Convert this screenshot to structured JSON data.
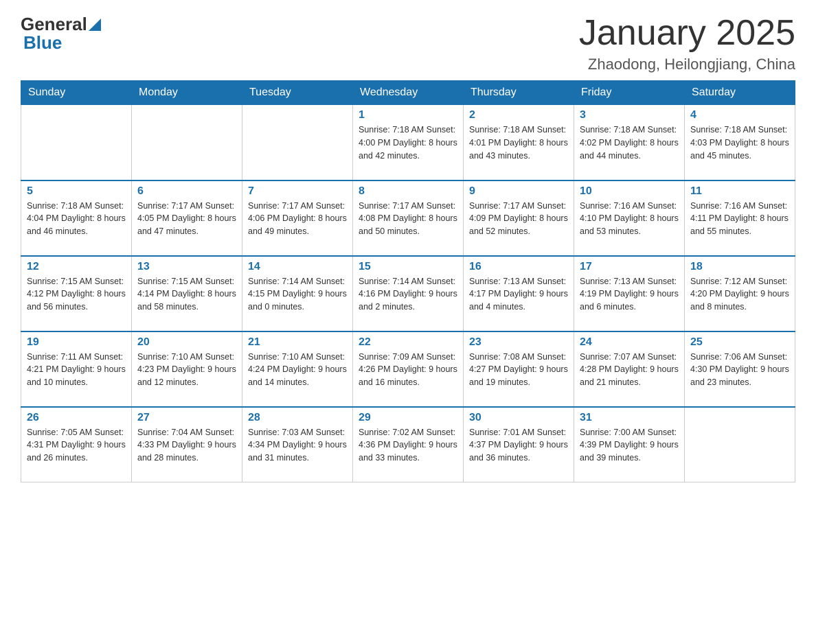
{
  "header": {
    "logo_general": "General",
    "logo_blue": "Blue",
    "title": "January 2025",
    "subtitle": "Zhaodong, Heilongjiang, China"
  },
  "calendar": {
    "days": [
      "Sunday",
      "Monday",
      "Tuesday",
      "Wednesday",
      "Thursday",
      "Friday",
      "Saturday"
    ],
    "weeks": [
      [
        {
          "day": "",
          "info": ""
        },
        {
          "day": "",
          "info": ""
        },
        {
          "day": "",
          "info": ""
        },
        {
          "day": "1",
          "info": "Sunrise: 7:18 AM\nSunset: 4:00 PM\nDaylight: 8 hours\nand 42 minutes."
        },
        {
          "day": "2",
          "info": "Sunrise: 7:18 AM\nSunset: 4:01 PM\nDaylight: 8 hours\nand 43 minutes."
        },
        {
          "day": "3",
          "info": "Sunrise: 7:18 AM\nSunset: 4:02 PM\nDaylight: 8 hours\nand 44 minutes."
        },
        {
          "day": "4",
          "info": "Sunrise: 7:18 AM\nSunset: 4:03 PM\nDaylight: 8 hours\nand 45 minutes."
        }
      ],
      [
        {
          "day": "5",
          "info": "Sunrise: 7:18 AM\nSunset: 4:04 PM\nDaylight: 8 hours\nand 46 minutes."
        },
        {
          "day": "6",
          "info": "Sunrise: 7:17 AM\nSunset: 4:05 PM\nDaylight: 8 hours\nand 47 minutes."
        },
        {
          "day": "7",
          "info": "Sunrise: 7:17 AM\nSunset: 4:06 PM\nDaylight: 8 hours\nand 49 minutes."
        },
        {
          "day": "8",
          "info": "Sunrise: 7:17 AM\nSunset: 4:08 PM\nDaylight: 8 hours\nand 50 minutes."
        },
        {
          "day": "9",
          "info": "Sunrise: 7:17 AM\nSunset: 4:09 PM\nDaylight: 8 hours\nand 52 minutes."
        },
        {
          "day": "10",
          "info": "Sunrise: 7:16 AM\nSunset: 4:10 PM\nDaylight: 8 hours\nand 53 minutes."
        },
        {
          "day": "11",
          "info": "Sunrise: 7:16 AM\nSunset: 4:11 PM\nDaylight: 8 hours\nand 55 minutes."
        }
      ],
      [
        {
          "day": "12",
          "info": "Sunrise: 7:15 AM\nSunset: 4:12 PM\nDaylight: 8 hours\nand 56 minutes."
        },
        {
          "day": "13",
          "info": "Sunrise: 7:15 AM\nSunset: 4:14 PM\nDaylight: 8 hours\nand 58 minutes."
        },
        {
          "day": "14",
          "info": "Sunrise: 7:14 AM\nSunset: 4:15 PM\nDaylight: 9 hours\nand 0 minutes."
        },
        {
          "day": "15",
          "info": "Sunrise: 7:14 AM\nSunset: 4:16 PM\nDaylight: 9 hours\nand 2 minutes."
        },
        {
          "day": "16",
          "info": "Sunrise: 7:13 AM\nSunset: 4:17 PM\nDaylight: 9 hours\nand 4 minutes."
        },
        {
          "day": "17",
          "info": "Sunrise: 7:13 AM\nSunset: 4:19 PM\nDaylight: 9 hours\nand 6 minutes."
        },
        {
          "day": "18",
          "info": "Sunrise: 7:12 AM\nSunset: 4:20 PM\nDaylight: 9 hours\nand 8 minutes."
        }
      ],
      [
        {
          "day": "19",
          "info": "Sunrise: 7:11 AM\nSunset: 4:21 PM\nDaylight: 9 hours\nand 10 minutes."
        },
        {
          "day": "20",
          "info": "Sunrise: 7:10 AM\nSunset: 4:23 PM\nDaylight: 9 hours\nand 12 minutes."
        },
        {
          "day": "21",
          "info": "Sunrise: 7:10 AM\nSunset: 4:24 PM\nDaylight: 9 hours\nand 14 minutes."
        },
        {
          "day": "22",
          "info": "Sunrise: 7:09 AM\nSunset: 4:26 PM\nDaylight: 9 hours\nand 16 minutes."
        },
        {
          "day": "23",
          "info": "Sunrise: 7:08 AM\nSunset: 4:27 PM\nDaylight: 9 hours\nand 19 minutes."
        },
        {
          "day": "24",
          "info": "Sunrise: 7:07 AM\nSunset: 4:28 PM\nDaylight: 9 hours\nand 21 minutes."
        },
        {
          "day": "25",
          "info": "Sunrise: 7:06 AM\nSunset: 4:30 PM\nDaylight: 9 hours\nand 23 minutes."
        }
      ],
      [
        {
          "day": "26",
          "info": "Sunrise: 7:05 AM\nSunset: 4:31 PM\nDaylight: 9 hours\nand 26 minutes."
        },
        {
          "day": "27",
          "info": "Sunrise: 7:04 AM\nSunset: 4:33 PM\nDaylight: 9 hours\nand 28 minutes."
        },
        {
          "day": "28",
          "info": "Sunrise: 7:03 AM\nSunset: 4:34 PM\nDaylight: 9 hours\nand 31 minutes."
        },
        {
          "day": "29",
          "info": "Sunrise: 7:02 AM\nSunset: 4:36 PM\nDaylight: 9 hours\nand 33 minutes."
        },
        {
          "day": "30",
          "info": "Sunrise: 7:01 AM\nSunset: 4:37 PM\nDaylight: 9 hours\nand 36 minutes."
        },
        {
          "day": "31",
          "info": "Sunrise: 7:00 AM\nSunset: 4:39 PM\nDaylight: 9 hours\nand 39 minutes."
        },
        {
          "day": "",
          "info": ""
        }
      ]
    ]
  }
}
